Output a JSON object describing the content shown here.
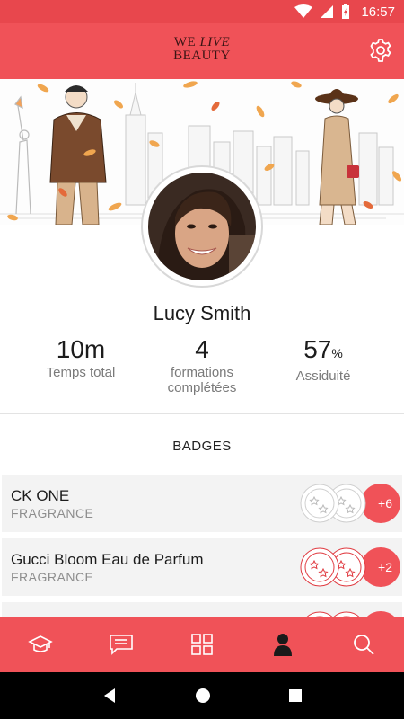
{
  "status_bar": {
    "time": "16:57"
  },
  "header": {
    "logo_line1_a": "WE",
    "logo_line1_b": "LIVE",
    "logo_line2": "BEAUTY"
  },
  "profile": {
    "name": "Lucy Smith",
    "stats": [
      {
        "value": "10m",
        "unit": "",
        "label": "Temps total"
      },
      {
        "value": "4",
        "unit": "",
        "label_line1": "formations",
        "label_line2": "complétées"
      },
      {
        "value": "57",
        "unit": "%",
        "label": "Assiduité"
      }
    ]
  },
  "badges": {
    "title": "BADGES",
    "items": [
      {
        "name": "CK ONE",
        "category": "FRAGRANCE",
        "more": "+6",
        "earned": false
      },
      {
        "name": "Gucci Bloom Eau de Parfum",
        "category": "FRAGRANCE",
        "more": "+2",
        "earned": true
      },
      {
        "name": "",
        "category": "",
        "more": "",
        "earned": true
      }
    ]
  },
  "bottom_nav": {
    "items": [
      "graduation-cap-icon",
      "chat-icon",
      "grid-icon",
      "profile-icon",
      "search-icon"
    ],
    "active_index": 3
  },
  "colors": {
    "accent": "#f05258",
    "status_bar": "#e8474d",
    "badge_bg": "#f3f3f3"
  }
}
